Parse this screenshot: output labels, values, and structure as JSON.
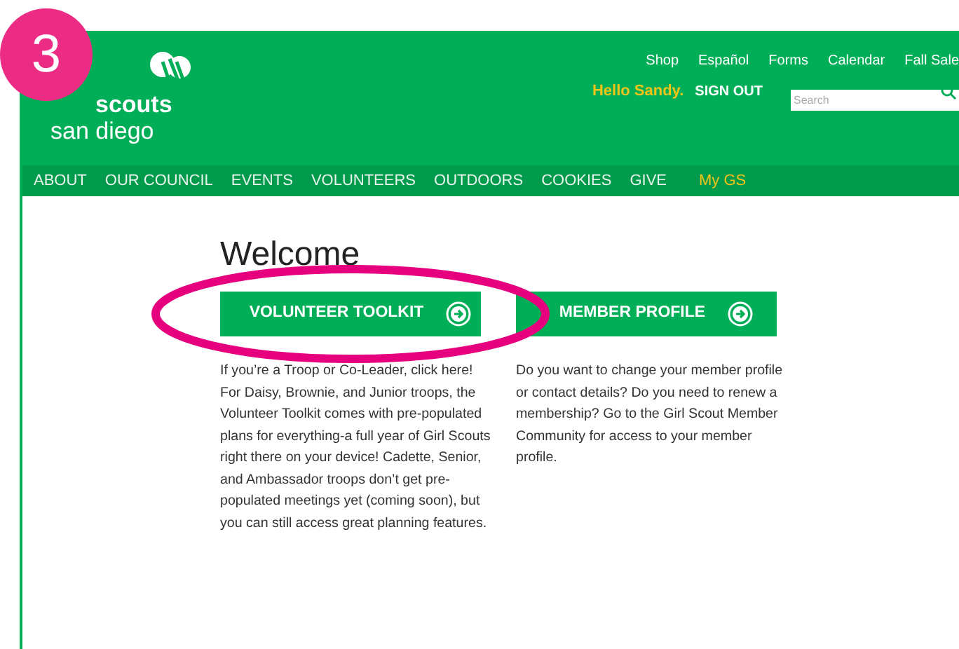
{
  "step_badge": "3",
  "logo": {
    "line1": "scouts",
    "line2": "san diego"
  },
  "utility_links": [
    "Shop",
    "Español",
    "Forms",
    "Calendar",
    "Fall Sale"
  ],
  "greeting": "Hello Sandy.",
  "sign_out": "SIGN OUT",
  "search": {
    "placeholder": "Search"
  },
  "nav": [
    {
      "label": "ABOUT",
      "kind": "main"
    },
    {
      "label": "OUR COUNCIL",
      "kind": "main"
    },
    {
      "label": "EVENTS",
      "kind": "main"
    },
    {
      "label": "VOLUNTEERS",
      "kind": "main"
    },
    {
      "label": "OUTDOORS",
      "kind": "main"
    },
    {
      "label": "COOKIES",
      "kind": "main"
    },
    {
      "label": "GIVE",
      "kind": "main"
    },
    {
      "label": "My GS",
      "kind": "account"
    }
  ],
  "heading": "Welcome",
  "cards": [
    {
      "button": "VOLUNTEER TOOLKIT",
      "highlighted": true,
      "text": "If you’re a Troop or Co-Leader, click here! For Daisy, Brownie, and Junior troops, the Volunteer Toolkit comes with pre-populated plans for everything-a full year of Girl Scouts right there on your device! Cadette, Senior, and Ambassador troops don’t get pre-populated meetings yet (coming soon), but you can still access great planning features."
    },
    {
      "button": "MEMBER PROFILE",
      "highlighted": false,
      "text": "Do you want to change your member profile or contact details? Do you need to renew a membership? Go to the Girl Scout Member Community for access to your member profile."
    }
  ]
}
